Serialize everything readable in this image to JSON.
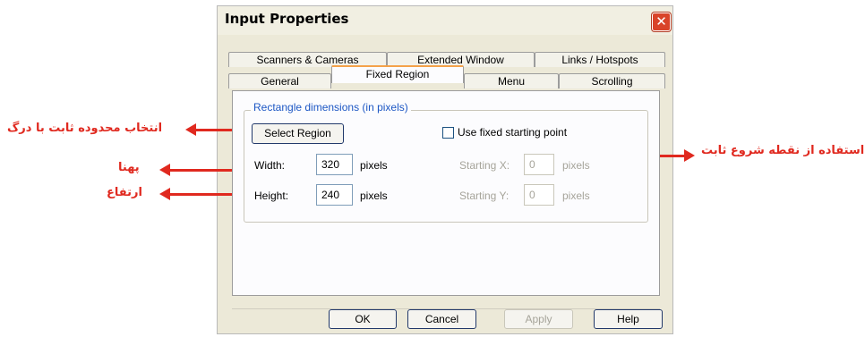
{
  "window": {
    "title": "Input Properties",
    "close_symbol": "✕"
  },
  "tabs_row1": [
    {
      "label": "Scanners & Cameras"
    },
    {
      "label": "Extended Window"
    },
    {
      "label": "Links / Hotspots"
    }
  ],
  "tabs_row2": [
    {
      "label": "General"
    },
    {
      "label": "Fixed Region",
      "active": true
    },
    {
      "label": "Menu"
    },
    {
      "label": "Scrolling"
    }
  ],
  "group": {
    "legend": "Rectangle dimensions (in pixels)",
    "select_region_label": "Select Region",
    "use_fixed_label": "Use fixed starting point",
    "width_label": "Width:",
    "width_value": "320",
    "height_label": "Height:",
    "height_value": "240",
    "pixels_unit": "pixels",
    "start_x_label": "Starting X:",
    "start_x_value": "0",
    "start_y_label": "Starting Y:",
    "start_y_value": "0"
  },
  "buttons": {
    "ok": "OK",
    "cancel": "Cancel",
    "apply": "Apply",
    "help": "Help"
  },
  "annotations": {
    "select_region": "انتخاب محدوده ثابت با درگ",
    "width": "پهنا",
    "height": "ارتفاع",
    "fixed_start": "استفاده از نقطه شروع ثابت"
  },
  "colors": {
    "annotation": "#e0291f",
    "title_bar": "#f1efe2",
    "active_tab_accent": "#f4a24a"
  }
}
